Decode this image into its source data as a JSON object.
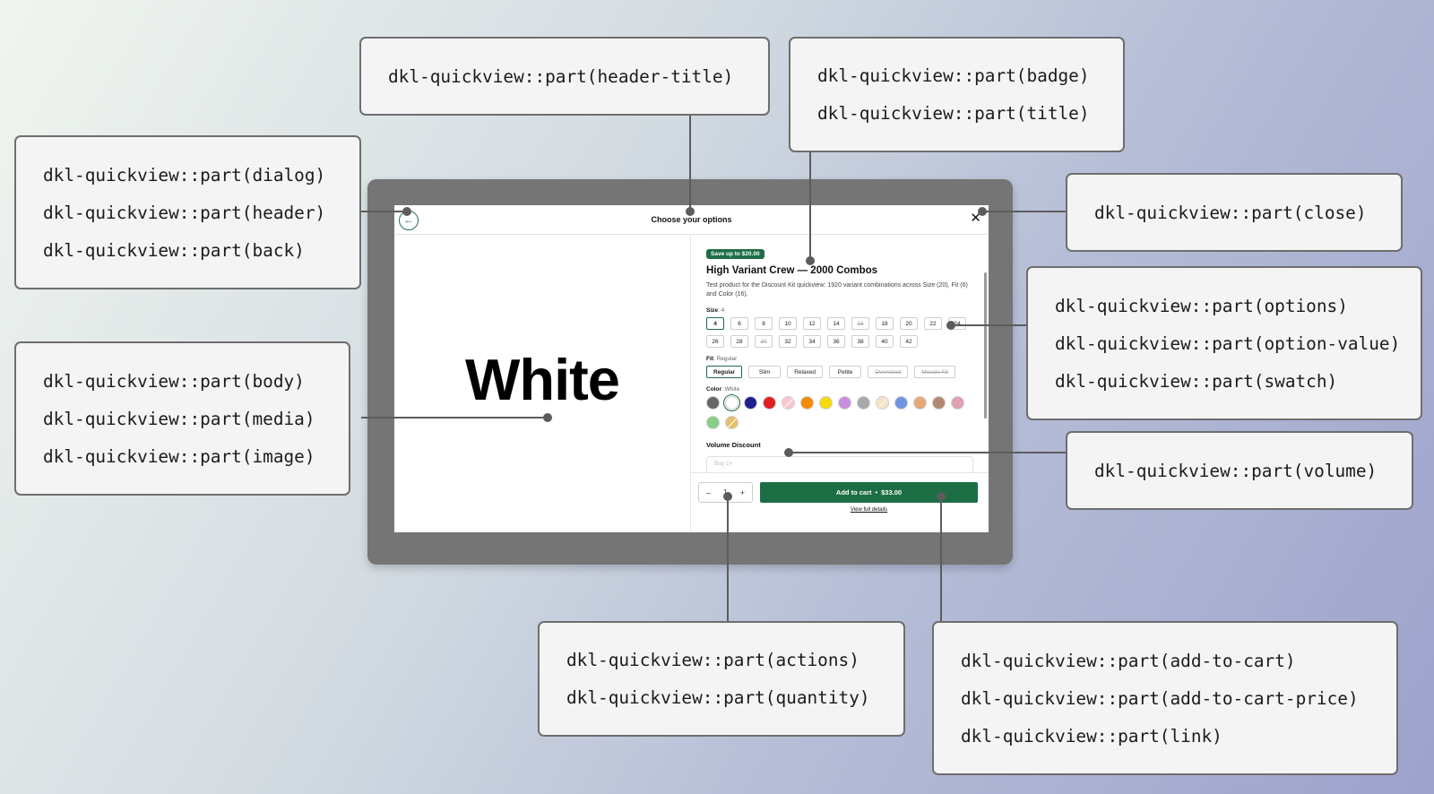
{
  "callouts": {
    "header_title": [
      "dkl-quickview::part(header-title)"
    ],
    "badge_title": [
      "dkl-quickview::part(badge)",
      "dkl-quickview::part(title)"
    ],
    "dialog_group": [
      "dkl-quickview::part(dialog)",
      "dkl-quickview::part(header)",
      "dkl-quickview::part(back)"
    ],
    "close": [
      "dkl-quickview::part(close)"
    ],
    "options_group": [
      "dkl-quickview::part(options)",
      "dkl-quickview::part(option-value)",
      "dkl-quickview::part(swatch)"
    ],
    "body_group": [
      "dkl-quickview::part(body)",
      "dkl-quickview::part(media)",
      "dkl-quickview::part(image)"
    ],
    "volume": [
      "dkl-quickview::part(volume)"
    ],
    "actions_group": [
      "dkl-quickview::part(actions)",
      "dkl-quickview::part(quantity)"
    ],
    "cart_group": [
      "dkl-quickview::part(add-to-cart)",
      "dkl-quickview::part(add-to-cart-price)",
      "dkl-quickview::part(link)"
    ]
  },
  "quickview": {
    "header_title": "Choose your options",
    "back_icon": "arrow-left-icon",
    "close_icon": "close-icon",
    "close_glyph": "✕",
    "back_glyph": "←",
    "image_text": "White",
    "badge": "Save up to $20.00",
    "title": "High Variant Crew — 2000 Combos",
    "description": "Test product for the Discount Kit quickview: 1920 variant combinations across Size (20), Fit (6) and Color (16).",
    "size": {
      "label": "Size",
      "selected": "4",
      "values": [
        {
          "v": "4",
          "state": "active"
        },
        {
          "v": "6",
          "state": ""
        },
        {
          "v": "8",
          "state": ""
        },
        {
          "v": "10",
          "state": ""
        },
        {
          "v": "12",
          "state": ""
        },
        {
          "v": "14",
          "state": ""
        },
        {
          "v": "16",
          "state": "dis"
        },
        {
          "v": "18",
          "state": ""
        },
        {
          "v": "20",
          "state": ""
        },
        {
          "v": "22",
          "state": ""
        },
        {
          "v": "24",
          "state": ""
        },
        {
          "v": "26",
          "state": ""
        },
        {
          "v": "28",
          "state": ""
        },
        {
          "v": "30",
          "state": "dis"
        },
        {
          "v": "32",
          "state": ""
        },
        {
          "v": "34",
          "state": ""
        },
        {
          "v": "36",
          "state": ""
        },
        {
          "v": "38",
          "state": ""
        },
        {
          "v": "40",
          "state": ""
        },
        {
          "v": "42",
          "state": ""
        }
      ]
    },
    "fit": {
      "label": "Fit",
      "selected": "Regular",
      "values": [
        {
          "v": "Regular",
          "state": "active"
        },
        {
          "v": "Slim",
          "state": ""
        },
        {
          "v": "Relaxed",
          "state": ""
        },
        {
          "v": "Petite",
          "state": ""
        },
        {
          "v": "Oversized",
          "state": "dis"
        },
        {
          "v": "Muscle Fit",
          "state": "dis"
        }
      ]
    },
    "color": {
      "label": "Color",
      "selected": "White",
      "swatches": [
        {
          "color": "#666666",
          "state": ""
        },
        {
          "color": "#ffffff",
          "state": "active"
        },
        {
          "color": "#1f1f8f",
          "state": ""
        },
        {
          "color": "#e02020",
          "state": ""
        },
        {
          "color": "#f7c6cf",
          "state": "dis"
        },
        {
          "color": "#f58a07",
          "state": ""
        },
        {
          "color": "#f5d90a",
          "state": ""
        },
        {
          "color": "#c88ee0",
          "state": ""
        },
        {
          "color": "#a9a9a9",
          "state": ""
        },
        {
          "color": "#f3e4c4",
          "state": "dis"
        },
        {
          "color": "#6f95e0",
          "state": ""
        },
        {
          "color": "#e3a97a",
          "state": ""
        },
        {
          "color": "#b08a70",
          "state": ""
        },
        {
          "color": "#e0a0b0",
          "state": ""
        },
        {
          "color": "#88cf88",
          "state": ""
        },
        {
          "color": "#e6c06a",
          "state": "dis"
        }
      ]
    },
    "volume_title": "Volume Discount",
    "volume_peek": "Buy 2+",
    "quantity": {
      "minus": "–",
      "value": "1",
      "plus": "+"
    },
    "add_to_cart": "Add to cart",
    "separator": "•",
    "price": "$33.00",
    "link": "View full details"
  },
  "colors": {
    "accent": "#1e6e45",
    "frame": "#757575",
    "connector": "#5c5c5c"
  }
}
